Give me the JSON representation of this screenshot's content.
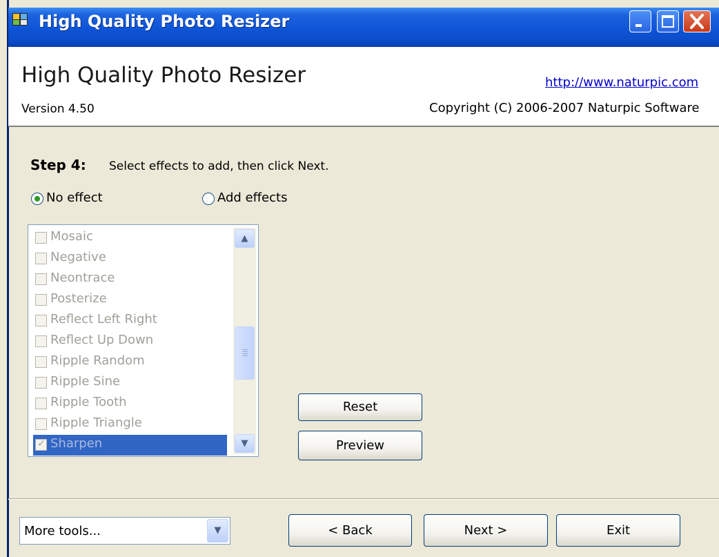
{
  "window": {
    "title": "High Quality Photo Resizer",
    "icon": "app-icon"
  },
  "header": {
    "app_title": "High Quality Photo Resizer",
    "url": "http://www.naturpic.com",
    "version": "Version 4.50",
    "copyright": "Copyright (C) 2006-2007 Naturpic Software"
  },
  "step": {
    "label": "Step 4:",
    "instruction": "Select effects to add, then click Next."
  },
  "options": {
    "no_effect": "No effect",
    "add_effects": "Add effects",
    "selected": "No effect"
  },
  "effects": {
    "items": [
      {
        "label": "Mosaic",
        "checked": false
      },
      {
        "label": "Negative",
        "checked": false
      },
      {
        "label": "Neontrace",
        "checked": false
      },
      {
        "label": "Posterize",
        "checked": false
      },
      {
        "label": "Reflect Left Right",
        "checked": false
      },
      {
        "label": "Reflect Up Down",
        "checked": false
      },
      {
        "label": "Ripple Random",
        "checked": false
      },
      {
        "label": "Ripple Sine",
        "checked": false
      },
      {
        "label": "Ripple Tooth",
        "checked": false
      },
      {
        "label": "Ripple Triangle",
        "checked": false
      },
      {
        "label": "Sharpen",
        "checked": true
      }
    ],
    "selected": "Sharpen"
  },
  "buttons": {
    "reset": "Reset",
    "preview": "Preview",
    "back": "< Back",
    "next": "Next >",
    "exit": "Exit"
  },
  "more_tools": {
    "value": "More tools..."
  }
}
